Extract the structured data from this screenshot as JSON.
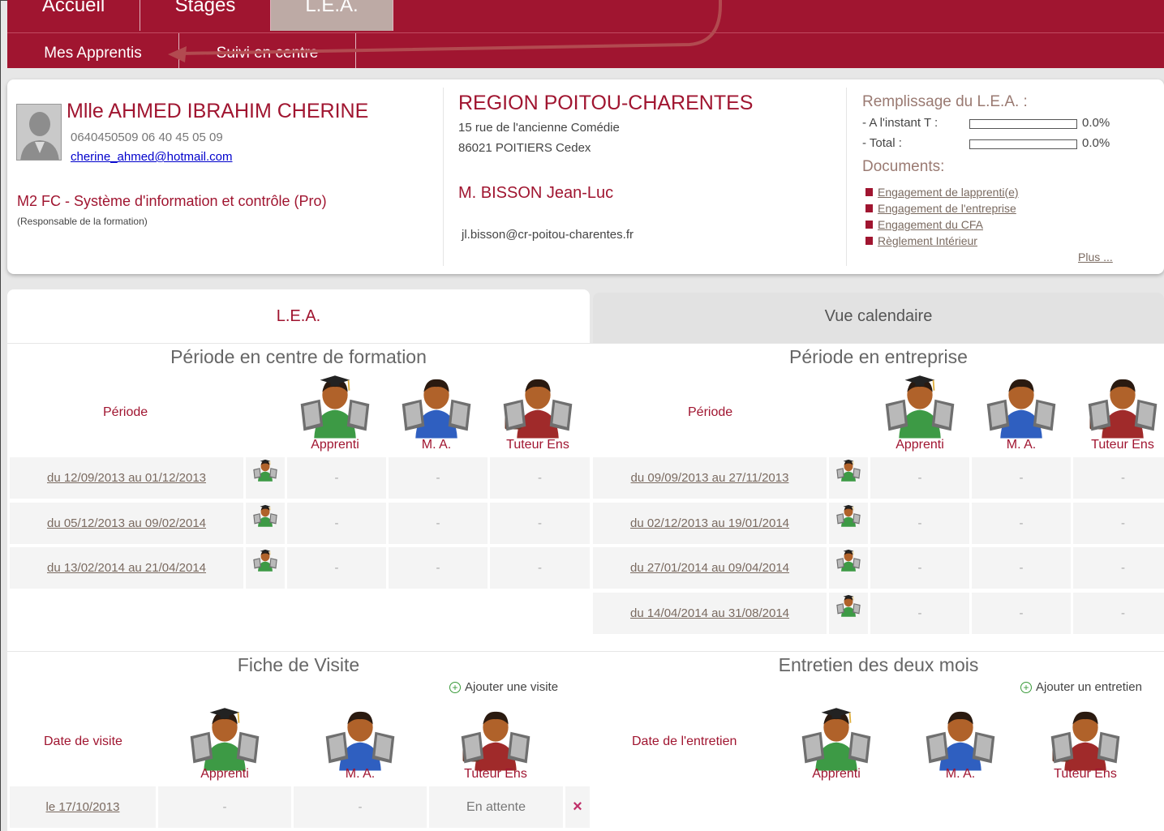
{
  "nav": {
    "top_tabs": [
      "Accueil",
      "Stages",
      "L.E.A."
    ],
    "sub_tabs": [
      "Mes Apprentis",
      "Suivi en centre"
    ]
  },
  "student": {
    "name": "Mlle AHMED IBRAHIM CHERINE",
    "phones": "0640450509 06 40 45 05 09",
    "email": "cherine_ahmed@hotmail.com",
    "program": "M2 FC - Système d'information et contrôle (Pro)",
    "role_note": "(Responsable de la formation)"
  },
  "company": {
    "name": "REGION POITOU-CHARENTES",
    "address1": "15 rue de l'ancienne Comédie",
    "address2": "86021 POITIERS Cedex",
    "contact": "M. BISSON Jean-Luc",
    "email": "jl.bisson@cr-poitou-charentes.fr"
  },
  "fill": {
    "title": "Remplissage du L.E.A. :",
    "instant_label": "- A l'instant T :",
    "instant_value": "0.0%",
    "instant_fraction": 0.0,
    "total_label": "- Total :",
    "total_value": "0.0%",
    "total_fraction": 0.0,
    "docs_title": "Documents:",
    "docs": [
      "Engagement de lapprenti(e)",
      "Engagement de l'entreprise",
      "Engagement du CFA",
      "Règlement Intérieur"
    ],
    "more": "Plus ..."
  },
  "tabs": {
    "lea": "L.E.A.",
    "calendar": "Vue calendaire"
  },
  "periods": {
    "center_title": "Période en centre de formation",
    "company_title": "Période en entreprise",
    "period_label": "Période",
    "roles": [
      "Apprenti",
      "M. A.",
      "Tuteur Ens"
    ],
    "center_rows": [
      {
        "period": "du 12/09/2013 au 01/12/2013",
        "a": "-",
        "b": "-",
        "c": "-"
      },
      {
        "period": "du 05/12/2013 au 09/02/2014",
        "a": "-",
        "b": "-",
        "c": "-"
      },
      {
        "period": "du 13/02/2014 au 21/04/2014",
        "a": "-",
        "b": "-",
        "c": "-"
      }
    ],
    "company_rows": [
      {
        "period": "du 09/09/2013 au 27/11/2013",
        "a": "-",
        "b": "-",
        "c": "-"
      },
      {
        "period": "du 02/12/2013 au 19/01/2014",
        "a": "-",
        "b": "-",
        "c": "-"
      },
      {
        "period": "du 27/01/2014 au 09/04/2014",
        "a": "-",
        "b": "-",
        "c": "-"
      },
      {
        "period": "du 14/04/2014 au 31/08/2014",
        "a": "-",
        "b": "-",
        "c": "-"
      }
    ]
  },
  "visits": {
    "title": "Fiche de Visite",
    "add": "Ajouter une visite",
    "date_label": "Date de visite",
    "rows": [
      {
        "date": "le 17/10/2013",
        "a": "-",
        "b": "-",
        "status": "En attente",
        "delete": "×"
      }
    ]
  },
  "interviews": {
    "title": "Entretien des deux mois",
    "add": "Ajouter un entretien",
    "date_label": "Date de l'entretien"
  },
  "colors": {
    "brand": "#a01530",
    "accent_arrow": "#b24a50"
  }
}
